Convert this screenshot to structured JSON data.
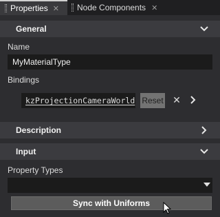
{
  "tabs": [
    {
      "label": "Properties",
      "close": "✕"
    },
    {
      "label": "Node Components",
      "close": "✕"
    }
  ],
  "sections": {
    "general": "General",
    "description": "Description",
    "input": "Input"
  },
  "name": {
    "label": "Name",
    "value": "MyMaterialType"
  },
  "bindings": {
    "label": "Bindings",
    "expression": "kzProjectionCameraWorld",
    "reset": "Reset",
    "remove": "✕"
  },
  "property_types": {
    "label": "Property Types",
    "selected": ""
  },
  "sync_button": "Sync with Uniforms",
  "colors": {
    "background": "#2d2d30",
    "section_header": "#3b3b3f",
    "input_bg": "#1b1b1b",
    "button": "#5c5c5c"
  },
  "icons": [
    "grip-icon",
    "close-icon",
    "chevron-down-icon",
    "chevron-right-icon",
    "dropdown-arrow-icon",
    "mouse-cursor-icon"
  ]
}
